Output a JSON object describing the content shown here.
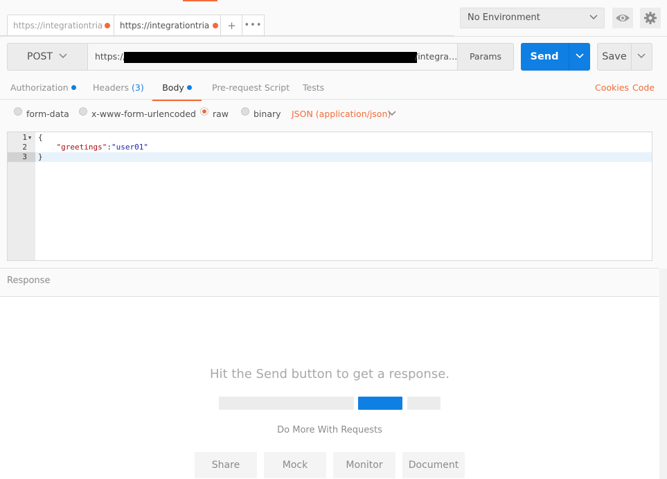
{
  "tabs": [
    {
      "label": "https://integrationtria",
      "active": false
    },
    {
      "label": "https://integrationtria",
      "active": true
    }
  ],
  "tab_actions": {
    "add_label": "+",
    "more_label": "•••"
  },
  "environment": {
    "selected": "No Environment"
  },
  "request": {
    "method": "POST",
    "url_prefix": "https://",
    "url_suffix": "/integra…",
    "params_label": "Params",
    "send_label": "Send",
    "save_label": "Save"
  },
  "request_tabs": {
    "authorization": "Authorization",
    "headers": "Headers",
    "headers_count": "(3)",
    "body": "Body",
    "pre_request": "Pre-request Script",
    "tests": "Tests",
    "cookies": "Cookies",
    "code": "Code"
  },
  "body_options": {
    "form_data": "form-data",
    "urlencoded": "x-www-form-urlencoded",
    "raw": "raw",
    "binary": "binary",
    "selected": "raw",
    "content_type": "JSON (application/json)"
  },
  "editor": {
    "lines": [
      {
        "num": "1",
        "text": "{"
      },
      {
        "num": "2",
        "key": "\"greetings\"",
        "sep": ":",
        "value": "\"user01\""
      },
      {
        "num": "3",
        "text": "}"
      }
    ]
  },
  "response": {
    "label": "Response",
    "hint": "Hit the Send button to get a response.",
    "do_more": "Do More With Requests",
    "actions": [
      "Share",
      "Mock",
      "Monitor",
      "Document"
    ]
  },
  "colors": {
    "accent": "#f26b3a",
    "primary": "#0f7fe3"
  }
}
